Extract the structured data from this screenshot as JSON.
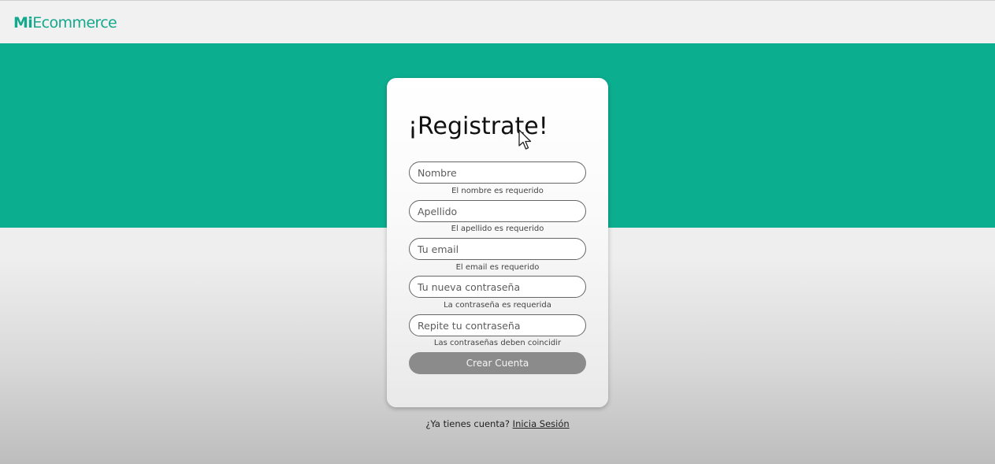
{
  "header": {
    "logo_bold": "Mi",
    "logo_light": "Ecommerce"
  },
  "colors": {
    "brand": "#0cae90",
    "logo": "#14a88c",
    "button": "#8b8b8b"
  },
  "form": {
    "title": "¡Registrate!",
    "fields": [
      {
        "name": "nombre",
        "placeholder": "Nombre",
        "value": "",
        "error": "El nombre es requerido"
      },
      {
        "name": "apellido",
        "placeholder": "Apellido",
        "value": "",
        "error": "El apellido es requerido"
      },
      {
        "name": "email",
        "placeholder": "Tu email",
        "value": "",
        "error": "El email es requerido"
      },
      {
        "name": "password",
        "placeholder": "Tu nueva contraseña",
        "value": "",
        "error": "La contraseña es requerida"
      },
      {
        "name": "password-confirm",
        "placeholder": "Repite tu contraseña",
        "value": "",
        "error": "Las contraseñas deben coincidir"
      }
    ],
    "submit_label": "Crear Cuenta"
  },
  "footer": {
    "question": "¿Ya tienes cuenta?",
    "login_link": "Inicia Sesión"
  },
  "cursor_icon": "arrow-cursor-icon"
}
